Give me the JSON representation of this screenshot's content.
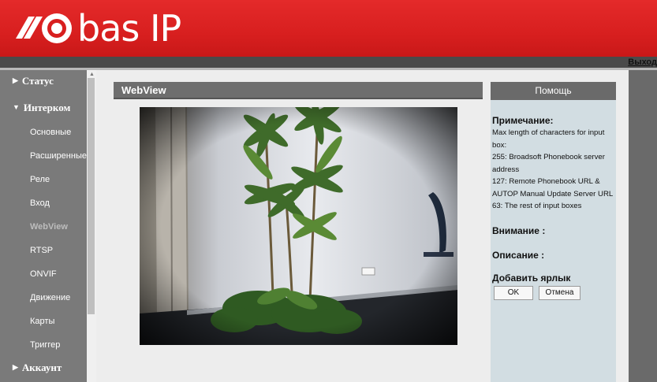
{
  "header": {
    "brand": "bas IP"
  },
  "topbar": {
    "logout": "Выход"
  },
  "sidebar": {
    "top_items": [
      {
        "label": "Статус",
        "expanded": false
      },
      {
        "label": "Интерком",
        "expanded": true
      },
      {
        "label": "Аккаунт",
        "expanded": false
      }
    ],
    "sub_items": [
      {
        "label": "Основные"
      },
      {
        "label": "Расширенные"
      },
      {
        "label": "Реле"
      },
      {
        "label": "Вход"
      },
      {
        "label": "WebView",
        "active": true
      },
      {
        "label": "RTSP"
      },
      {
        "label": "ONVIF"
      },
      {
        "label": "Движение"
      },
      {
        "label": "Карты"
      },
      {
        "label": "Триггер"
      }
    ]
  },
  "content": {
    "title": "WebView"
  },
  "help": {
    "title": "Помощь",
    "note_title": "Примечание:",
    "note_lines": [
      "Max length of characters for input box:",
      "255: Broadsoft Phonebook server address",
      "127: Remote Phonebook URL & AUTOP Manual Update Server URL",
      "63: The rest of input boxes"
    ],
    "warning_title": "Внимание :",
    "description_title": "Описание :",
    "shortcut_title": "Добавить ярлык",
    "ok_label": "OK",
    "cancel_label": "Отмена"
  },
  "colors": {
    "header_red": "#d81f1f",
    "sidebar_gray": "#7a7a7a",
    "help_bg": "#d2dde2",
    "content_bg": "#ededed"
  }
}
